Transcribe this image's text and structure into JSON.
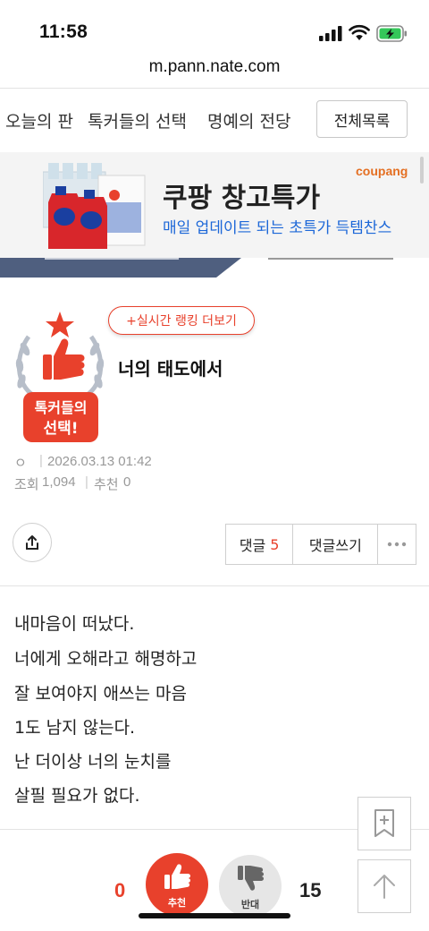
{
  "status_bar": {
    "time": "11:58"
  },
  "browser": {
    "url": "m.pann.nate.com"
  },
  "nav": {
    "items": [
      "오늘의 판",
      "톡커들의 선택",
      "명예의 전당"
    ],
    "list_button": "전체목록"
  },
  "ad": {
    "brand": "coupang",
    "title": "쿠팡 창고특가",
    "subtitle": "매일 업데이트 되는 초특가 득템찬스"
  },
  "badge": {
    "line1": "톡커들의",
    "line2": "선택!"
  },
  "post": {
    "ranking_button": "+실시간 랭킹 더보기",
    "title": "너의 태도에서",
    "author": "ㅇ",
    "date": "2026.03.13 01:42",
    "views_label": "조회",
    "views": "1,094",
    "recommend_label": "추천",
    "recommend": "0",
    "body": [
      "내마음이 떠났다.",
      "너에게 오해라고 해명하고",
      "잘 보여야지 애쓰는 마음",
      "1도 남지 않는다.",
      "난 더이상 너의 눈치를",
      "살필 필요가 없다."
    ]
  },
  "actions": {
    "comment_label": "댓글",
    "comment_count": "5",
    "write_comment": "댓글쓰기"
  },
  "votes": {
    "up_count": "0",
    "up_label": "추천",
    "down_label": "반대",
    "down_count": "15"
  },
  "colors": {
    "accent": "#e8412c",
    "ad_blue": "#1c67d8",
    "coupang": "#e46f22"
  }
}
